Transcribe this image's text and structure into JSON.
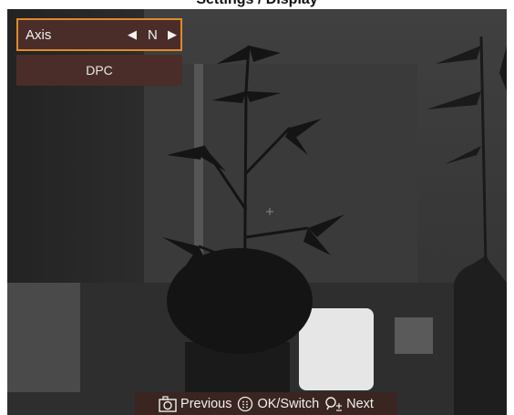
{
  "header": {
    "title": "Settings / Display"
  },
  "menu": {
    "axis_label": "Axis",
    "axis_value": "N",
    "prev_arrow_icon": "triangle-left-icon",
    "next_arrow_icon": "triangle-right-icon",
    "dpc_label": "DPC"
  },
  "hints": {
    "previous_label": "Previous",
    "ok_label": "OK/Switch",
    "next_label": "Next",
    "previous_icon": "camera-icon",
    "ok_icon": "menu-button-icon",
    "next_icon": "zoom-icon"
  },
  "colors": {
    "selected_border": "#e0892a",
    "menu_background": "#4a2d28",
    "hint_background": "#3a2520"
  }
}
